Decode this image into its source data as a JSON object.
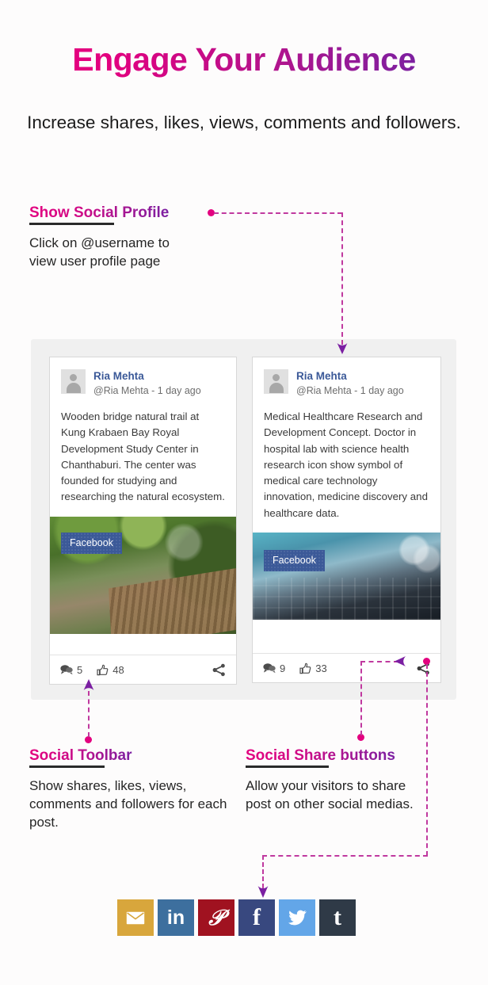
{
  "hero": {
    "title": "Engage Your Audience",
    "subtitle": "Increase shares, likes, views, comments and followers.",
    "gradient_start": "#e3007f",
    "gradient_end": "#6a1fa8"
  },
  "callouts": [
    {
      "id": "show-social-profile",
      "title": "Show Social Profile",
      "body": "Click on @username to view user profile page"
    },
    {
      "id": "social-toolbar",
      "title": "Social Toolbar",
      "body": "Show shares, likes, views, comments and followers for each post."
    },
    {
      "id": "social-share-buttons",
      "title": "Social Share buttons",
      "body": "Allow your visitors to share post on other social medias."
    }
  ],
  "feed": {
    "background": "#f0f0f0",
    "posts": [
      {
        "author": "Ria Mehta",
        "meta": "@Ria Mehta - 1 day ago",
        "text": "Wooden bridge natural trail at Kung Krabaen Bay Royal Development Study Center in Chanthaburi. The center was founded for studying and researching the natural ecosystem.",
        "network_badge": "Facebook",
        "badge_color": "#3b5998",
        "image_alt": "wooden-bridge-forest-photo",
        "toolbar": {
          "comments": "5",
          "likes": "48",
          "comment_icon": "comments-icon",
          "like_icon": "thumbs-up-icon",
          "share_icon": "share-icon"
        }
      },
      {
        "author": "Ria Mehta",
        "meta": "@Ria Mehta - 1 day ago",
        "text": "Medical Healthcare Research and Development Concept. Doctor in hospital lab with science health research icon show symbol of medical care technology innovation, medicine discovery and healthcare data.",
        "network_badge": "Facebook",
        "badge_color": "#3b5998",
        "image_alt": "medical-technology-photo",
        "toolbar": {
          "comments": "9",
          "likes": "33",
          "comment_icon": "comments-icon",
          "like_icon": "thumbs-up-icon",
          "share_icon": "share-icon"
        }
      }
    ]
  },
  "share_buttons": [
    {
      "name": "email",
      "glyph": "✉",
      "color": "#d8a63c"
    },
    {
      "name": "linkedin",
      "glyph": "in",
      "color": "#3d6f9e"
    },
    {
      "name": "pinterest",
      "glyph": "𝒫",
      "color": "#a01220"
    },
    {
      "name": "facebook",
      "glyph": "f",
      "color": "#38487f"
    },
    {
      "name": "twitter",
      "glyph": "ᴠ",
      "color": "#63a6e8"
    },
    {
      "name": "tumblr",
      "glyph": "t",
      "color": "#2f3a47"
    }
  ],
  "connectors": {
    "dot_color": "#e3007f",
    "line_color": "#c0399f",
    "arrow_color": "#7b1fa2"
  }
}
